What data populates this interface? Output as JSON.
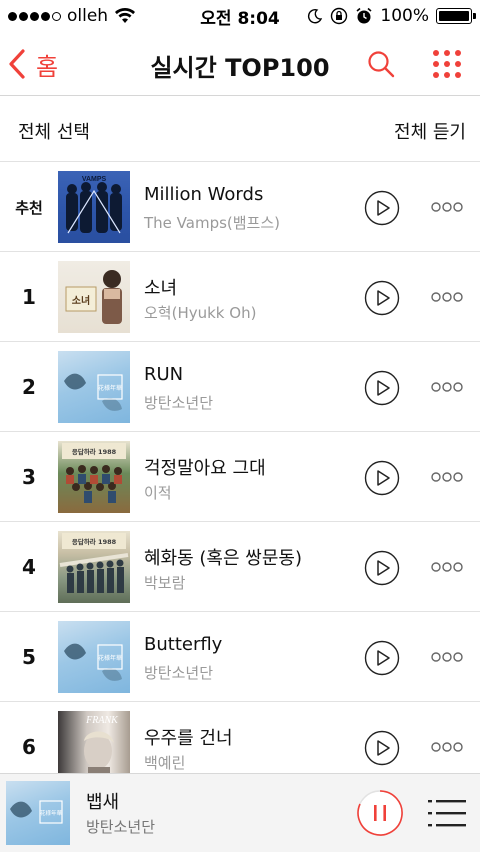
{
  "status": {
    "carrier": "olleh",
    "time": "오전 8:04",
    "battery": "100%",
    "battery_level": 1.0
  },
  "nav": {
    "back_label": "홈",
    "title": "실시간 TOP100",
    "accent": "#f0413a"
  },
  "select_bar": {
    "select_all": "전체 선택",
    "play_all": "전체 듣기"
  },
  "chart": [
    {
      "rank": "추천",
      "song": "Million Words",
      "artist": "The Vamps(뱀프스)",
      "art_text": "VAMPS"
    },
    {
      "rank": "1",
      "song": "소녀",
      "artist": "오혁(Hyukk Oh)",
      "art_text": "소녀"
    },
    {
      "rank": "2",
      "song": "RUN",
      "artist": "방탄소년단",
      "art_text": "花様年華"
    },
    {
      "rank": "3",
      "song": "걱정말아요 그대",
      "artist": "이적",
      "art_text": "응답하라 1988"
    },
    {
      "rank": "4",
      "song": "혜화동 (혹은 쌍문동)",
      "artist": "박보람",
      "art_text": "응답하라 1988"
    },
    {
      "rank": "5",
      "song": "Butterfly",
      "artist": "방탄소년단",
      "art_text": "花様年華"
    },
    {
      "rank": "6",
      "song": "우주를 건너",
      "artist": "백예린",
      "art_text": "FRANK"
    }
  ],
  "player": {
    "song": "뱁새",
    "artist": "방탄소년단",
    "art_text": "花様年華",
    "accent": "#f0413a"
  }
}
